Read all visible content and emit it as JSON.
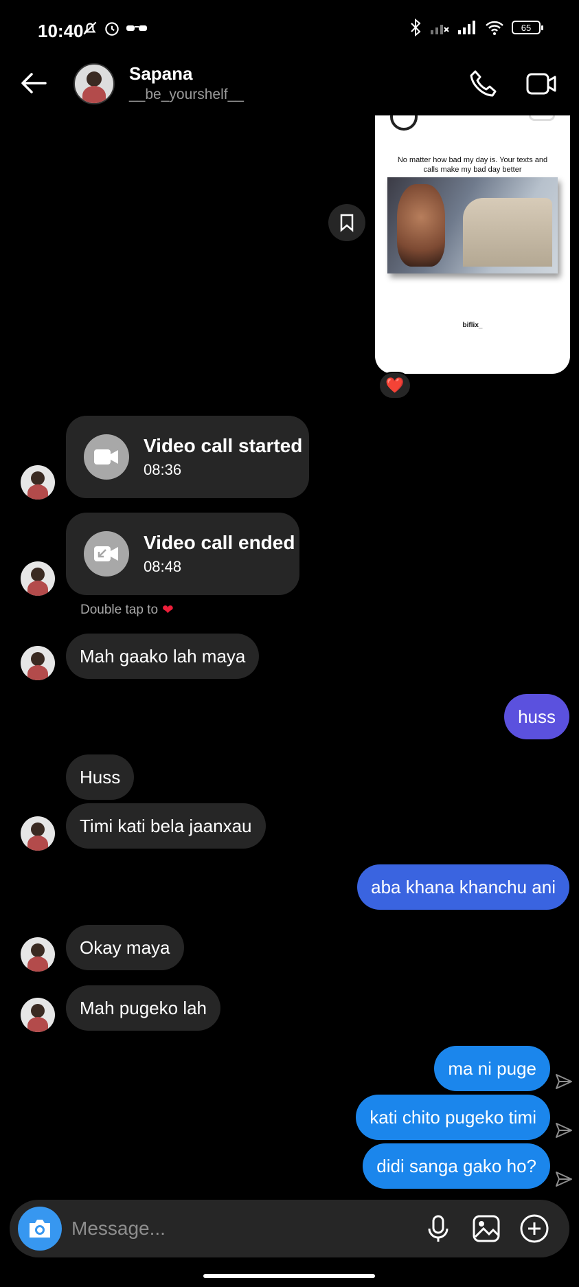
{
  "status_bar": {
    "time": "10:40",
    "battery": "65"
  },
  "header": {
    "contact_name": "Sapana",
    "username": "__be_yourshelf__"
  },
  "shared_post": {
    "caption": "No matter how bad my day is. Your texts and calls make my bad day better",
    "credit": "biflix_",
    "reaction": "❤️"
  },
  "calls": [
    {
      "title": "Video call started",
      "time": "08:36"
    },
    {
      "title": "Video call ended",
      "time": "08:48"
    }
  ],
  "double_tap_hint": "Double tap to",
  "messages": [
    {
      "dir": "in",
      "text": "Mah gaako lah maya"
    },
    {
      "dir": "out",
      "text": "huss",
      "color": "#5b51de"
    },
    {
      "dir": "in",
      "text": "Huss"
    },
    {
      "dir": "in",
      "text": "Timi kati bela jaanxau"
    },
    {
      "dir": "out",
      "text": "aba khana khanchu ani",
      "color": "#3a64e0"
    },
    {
      "dir": "in",
      "text": "Okay maya"
    },
    {
      "dir": "in",
      "text": "Mah pugeko lah"
    },
    {
      "dir": "out",
      "text": "ma ni puge",
      "color": "#1b86ec"
    },
    {
      "dir": "out",
      "text": "kati chito pugeko timi",
      "color": "#1b86ec"
    },
    {
      "dir": "out",
      "text": "didi sanga gako ho?",
      "color": "#1b86ec"
    }
  ],
  "composer": {
    "placeholder": "Message..."
  },
  "colors": {
    "background": "#000000",
    "incoming_bubble": "#262626",
    "camera_button": "#3797f0"
  }
}
